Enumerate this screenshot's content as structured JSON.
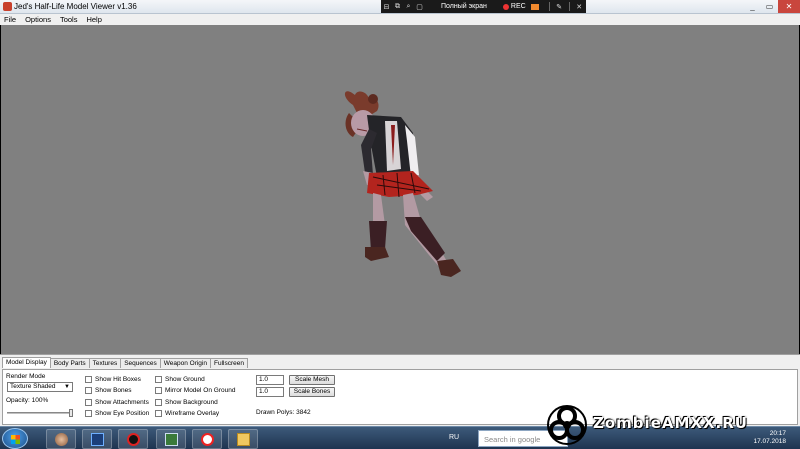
{
  "window": {
    "title": "Jed's Half-Life Model Viewer v1.36",
    "controls": [
      "_",
      "▭",
      "✕"
    ]
  },
  "recorder": {
    "fullscreen_label": "Полный экран",
    "rec_label": "REC"
  },
  "menu": [
    "File",
    "Options",
    "Tools",
    "Help"
  ],
  "tabs": [
    "Model Display",
    "Body Parts",
    "Textures",
    "Sequences",
    "Weapon Origin",
    "Fullscreen"
  ],
  "display": {
    "render_mode_label": "Render Mode",
    "render_mode_value": "Texture Shaded",
    "opacity_label": "Opacity: 100%",
    "opacity_value": 1.0,
    "checkboxes_col1": [
      "Show Hit Boxes",
      "Show Bones",
      "Show Attachments",
      "Show Eye Position"
    ],
    "checkboxes_col2": [
      "Show Ground",
      "Mirror Model On Ground",
      "Show Background",
      "Wireframe Overlay"
    ],
    "scale_mesh_value": "1.0",
    "scale_mesh_button": "Scale Mesh",
    "scale_bones_value": "1.0",
    "scale_bones_button": "Scale Bones",
    "drawn_polys": "Drawn Polys: 3842"
  },
  "taskbar": {
    "language": "RU",
    "search_placeholder": "Search in google",
    "time": "20:17",
    "date": "17.07.2018"
  },
  "watermark": {
    "brand": "ZombieAMXX.RU"
  },
  "colors": {
    "viewport": "#808080",
    "panel": "#f0f0f0",
    "taskbar": "#2a4566"
  }
}
